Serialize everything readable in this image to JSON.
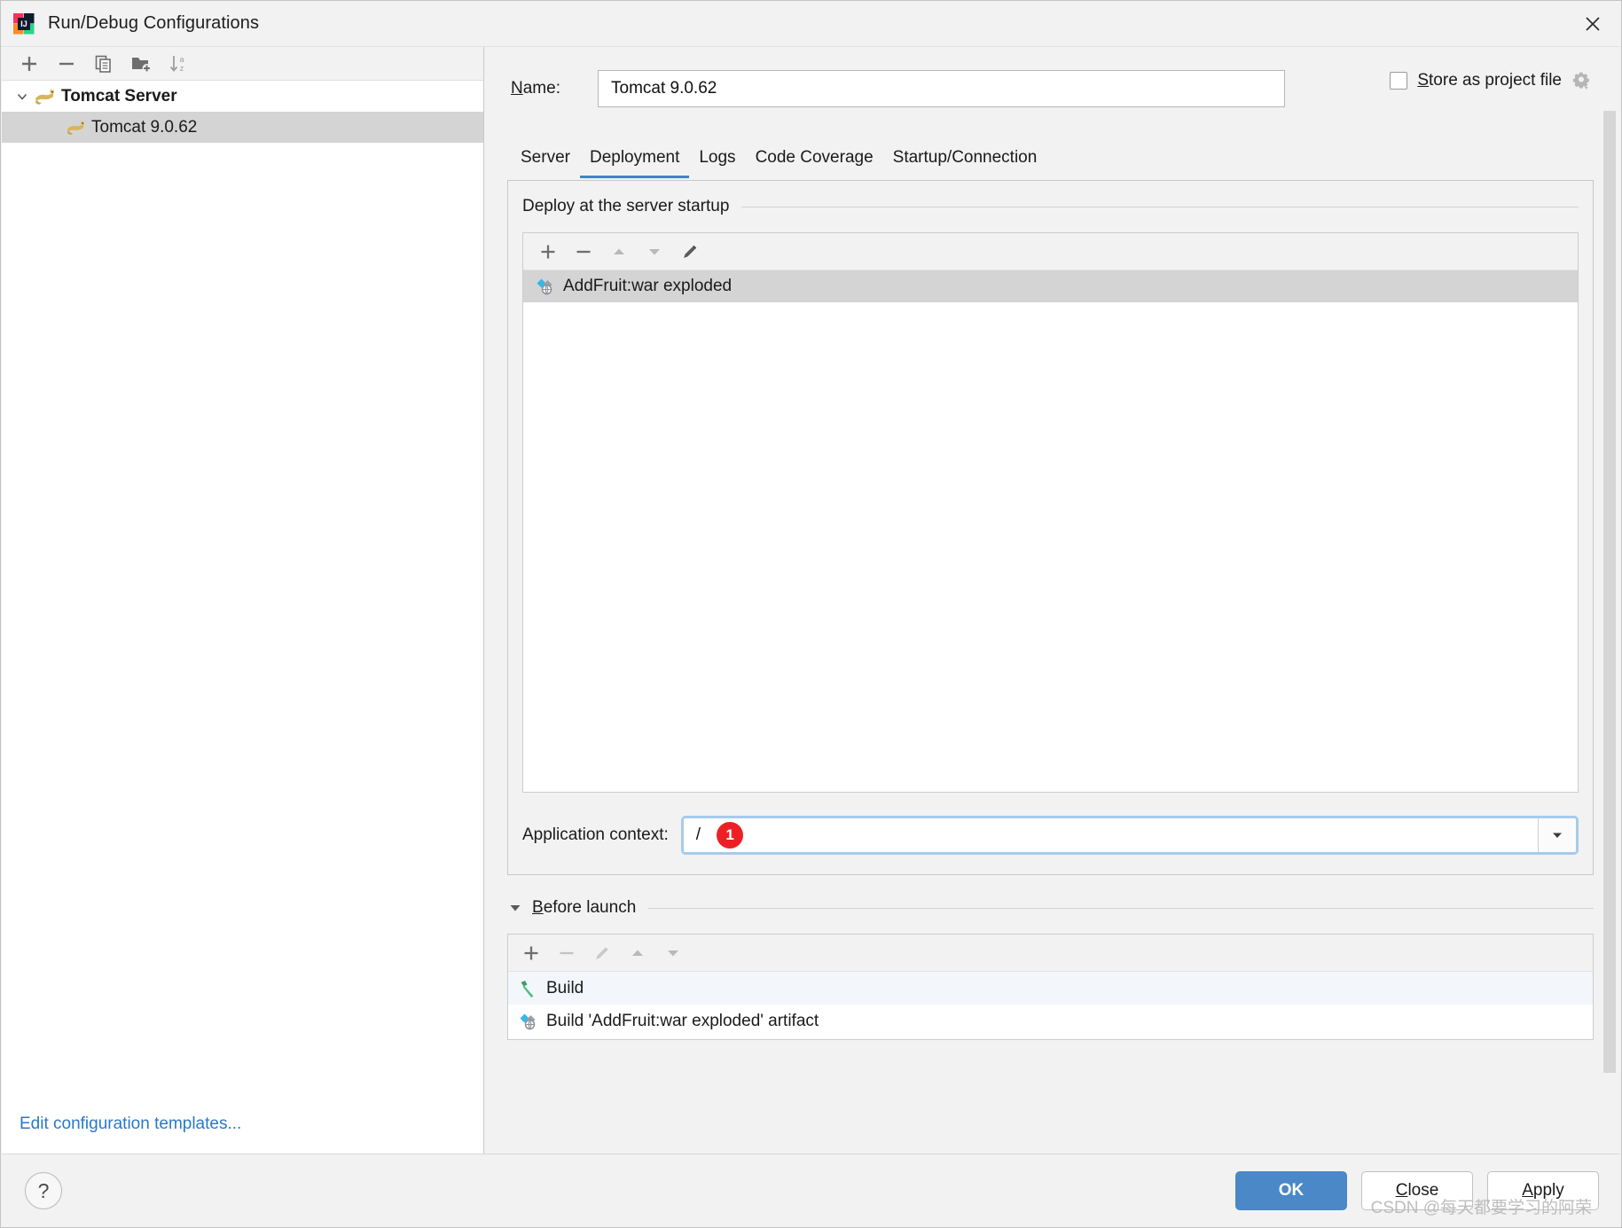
{
  "window": {
    "title": "Run/Debug Configurations",
    "app_icon": "intellij-idea-logo",
    "close_icon": "close-icon"
  },
  "left_panel": {
    "toolbar": [
      {
        "name": "add-configuration-button",
        "icon": "plus-icon"
      },
      {
        "name": "remove-configuration-button",
        "icon": "minus-icon"
      },
      {
        "name": "copy-configuration-button",
        "icon": "copy-icon"
      },
      {
        "name": "new-folder-button",
        "icon": "folder-add-icon"
      },
      {
        "name": "sort-configurations-button",
        "icon": "sort-alphabetical-icon"
      }
    ],
    "tree": [
      {
        "label": "Tomcat Server",
        "icon": "tomcat-icon",
        "level": 0,
        "expanded": true,
        "selected": false
      },
      {
        "label": "Tomcat 9.0.62",
        "icon": "tomcat-icon",
        "level": 1,
        "expanded": false,
        "selected": true
      }
    ],
    "edit_templates_link": "Edit configuration templates..."
  },
  "header": {
    "name_label": "Name:",
    "name_label_mnemonic": "N",
    "name_label_rest": "ame:",
    "name_value": "Tomcat 9.0.62",
    "store_as_project_file": {
      "checked": false,
      "mnemonic": "S",
      "rest": "tore as project file",
      "full": "Store as project file",
      "gear_icon": "gear-dropdown-icon"
    }
  },
  "tabs": [
    {
      "label": "Server",
      "active": false
    },
    {
      "label": "Deployment",
      "active": true
    },
    {
      "label": "Logs",
      "active": false
    },
    {
      "label": "Code Coverage",
      "active": false
    },
    {
      "label": "Startup/Connection",
      "active": false
    }
  ],
  "deployment": {
    "group_title": "Deploy at the server startup",
    "toolbar": [
      {
        "name": "add-artifact-button",
        "icon": "plus-icon",
        "enabled": true
      },
      {
        "name": "remove-artifact-button",
        "icon": "minus-icon",
        "enabled": true
      },
      {
        "name": "move-up-button",
        "icon": "arrow-up-icon",
        "enabled": false
      },
      {
        "name": "move-down-button",
        "icon": "arrow-down-icon",
        "enabled": false
      },
      {
        "name": "edit-artifact-button",
        "icon": "pencil-icon",
        "enabled": true
      }
    ],
    "items": [
      {
        "label": "AddFruit:war exploded",
        "icon": "artifact-icon",
        "selected": true
      }
    ],
    "application_context": {
      "label": "Application context:",
      "value": "/",
      "badge": "1",
      "badge_color": "#ec2024",
      "dropdown_icon": "chevron-down-icon",
      "focused": true
    }
  },
  "before_launch": {
    "header": "Before launch",
    "header_mnemonic": "B",
    "header_rest": "efore launch",
    "expanded": true,
    "collapse_icon": "triangle-down-icon",
    "toolbar": [
      {
        "name": "add-task-button",
        "icon": "plus-icon",
        "enabled": true
      },
      {
        "name": "remove-task-button",
        "icon": "minus-icon",
        "enabled": false
      },
      {
        "name": "edit-task-button",
        "icon": "pencil-icon",
        "enabled": false
      },
      {
        "name": "move-task-up-button",
        "icon": "arrow-up-icon",
        "enabled": false
      },
      {
        "name": "move-task-down-button",
        "icon": "arrow-down-icon",
        "enabled": false
      }
    ],
    "tasks": [
      {
        "label": "Build",
        "icon": "build-hammer-icon",
        "highlight": true
      },
      {
        "label": "Build 'AddFruit:war exploded' artifact",
        "icon": "artifact-icon",
        "highlight": false
      }
    ]
  },
  "footer": {
    "help_label": "?",
    "buttons": [
      {
        "label": "OK",
        "primary": true,
        "name": "ok-button"
      },
      {
        "label": "Close",
        "mnemonic": "C",
        "rest": "lose",
        "primary": false,
        "name": "close-button"
      },
      {
        "label": "Apply",
        "mnemonic": "A",
        "rest": "pply",
        "primary": false,
        "name": "apply-button"
      }
    ]
  },
  "watermark": "CSDN @每天都要学习的阿荣",
  "colors": {
    "accent_blue": "#4a88c7",
    "tab_underline": "#4083c9",
    "link_blue": "#2979c9",
    "badge_red": "#ec2024",
    "selection_gray": "#d4d4d4",
    "panel_bg": "#f2f2f2"
  }
}
